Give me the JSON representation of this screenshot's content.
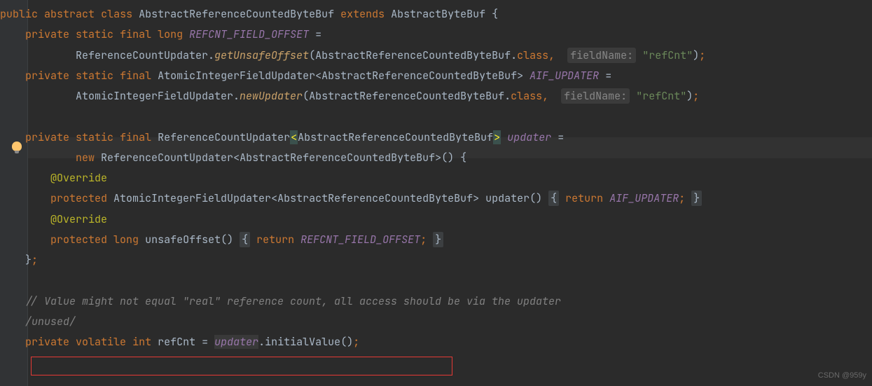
{
  "code": {
    "l1_public": "public",
    "l1_abstract": "abstract",
    "l1_class": "class",
    "l1_classname": "AbstractReferenceCountedByteBuf",
    "l1_extends": "extends",
    "l1_super": "AbstractByteBuf",
    "l2_private": "private",
    "l2_static": "static",
    "l2_final": "final",
    "l2_long": "long",
    "l2_field": "REFCNT_FIELD_OFFSET",
    "l3_type": "ReferenceCountUpdater",
    "l3_method": "getUnsafeOffset",
    "l3_arg1_type": "AbstractReferenceCountedByteBuf",
    "l3_class": "class",
    "l3_hint": "fieldName:",
    "l3_str": "\"refCnt\"",
    "l4_private": "private",
    "l4_static": "static",
    "l4_final": "final",
    "l4_type": "AtomicIntegerFieldUpdater",
    "l4_generic": "AbstractReferenceCountedByteBuf",
    "l4_field": "AIF_UPDATER",
    "l5_type": "AtomicIntegerFieldUpdater",
    "l5_method": "newUpdater",
    "l5_arg1_type": "AbstractReferenceCountedByteBuf",
    "l5_class": "class",
    "l5_hint": "fieldName:",
    "l5_str": "\"refCnt\"",
    "l7_private": "private",
    "l7_static": "static",
    "l7_final": "final",
    "l7_type": "ReferenceCountUpdater",
    "l7_generic": "AbstractReferenceCountedByteBuf",
    "l7_field": "updater",
    "l8_new": "new",
    "l8_type": "ReferenceCountUpdater",
    "l8_generic": "AbstractReferenceCountedByteBuf",
    "l9_override": "@Override",
    "l10_protected": "protected",
    "l10_type": "AtomicIntegerFieldUpdater",
    "l10_generic": "AbstractReferenceCountedByteBuf",
    "l10_method": "updater",
    "l10_return": "return",
    "l10_field": "AIF_UPDATER",
    "l11_override": "@Override",
    "l12_protected": "protected",
    "l12_long": "long",
    "l12_method": "unsafeOffset",
    "l12_return": "return",
    "l12_field": "REFCNT_FIELD_OFFSET",
    "l15_comment": "// Value might not equal \"real\" reference count, all access should be via the updater",
    "l16_unused": "/unused/",
    "l17_private": "private",
    "l17_volatile": "volatile",
    "l17_int": "int",
    "l17_field": "refCnt",
    "l17_updater": "updater",
    "l17_method": "initialValue"
  },
  "watermark": "CSDN @959y"
}
